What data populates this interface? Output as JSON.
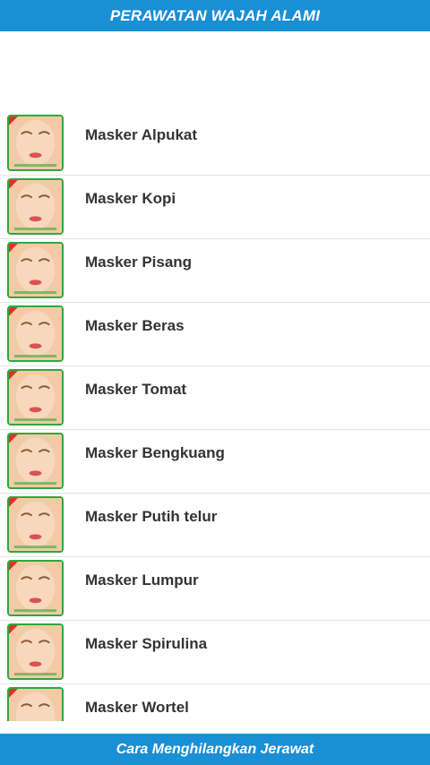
{
  "header": {
    "title": "PERAWATAN WAJAH ALAMI"
  },
  "list": {
    "items": [
      {
        "label": "Masker Alpukat"
      },
      {
        "label": "Masker Kopi"
      },
      {
        "label": "Masker Pisang"
      },
      {
        "label": "Masker Beras"
      },
      {
        "label": "Masker Tomat"
      },
      {
        "label": "Masker Bengkuang"
      },
      {
        "label": "Masker Putih telur"
      },
      {
        "label": "Masker Lumpur"
      },
      {
        "label": "Masker Spirulina"
      },
      {
        "label": "Masker Wortel"
      }
    ],
    "thumbnail_icon": "face-thumbnail-icon"
  },
  "footer": {
    "title": "Cara Menghilangkan Jerawat"
  },
  "colors": {
    "bar": "#1a8fd6",
    "thumb_border": "#2fa83a",
    "row_divider": "#e4e4e4",
    "label_text": "#333333"
  }
}
